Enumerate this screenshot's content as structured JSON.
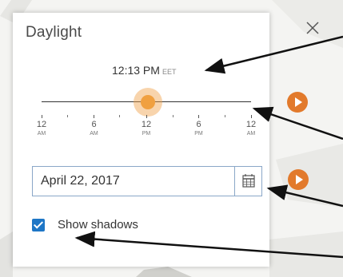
{
  "panel": {
    "title": "Daylight",
    "close_icon": "close-icon"
  },
  "time": {
    "value": "12:13 PM",
    "timezone": "EET"
  },
  "slider": {
    "value_fraction": 0.507,
    "ticks": [
      {
        "hour": "12",
        "period": "AM"
      },
      {
        "hour": "6",
        "period": "AM"
      },
      {
        "hour": "12",
        "period": "PM"
      },
      {
        "hour": "6",
        "period": "PM"
      },
      {
        "hour": "12",
        "period": "AM"
      }
    ]
  },
  "date": {
    "value": "April 22, 2017",
    "calendar_icon": "calendar-icon"
  },
  "shadows": {
    "label": "Show shadows",
    "checked": true
  },
  "play_icon": "play-icon",
  "colors": {
    "accent": "#e27a2c",
    "handle": "#f0a040",
    "checkbox": "#1e76c6",
    "input_border": "#8aa7c8"
  }
}
